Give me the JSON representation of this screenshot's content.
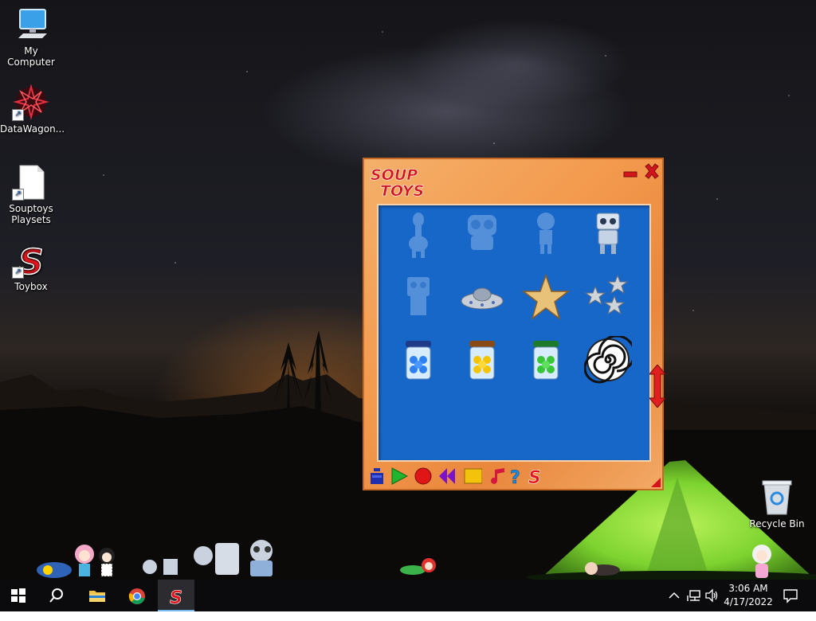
{
  "desktop": {
    "icons": [
      {
        "label": "My Computer",
        "icon": "computer-icon"
      },
      {
        "label": "DataWagon...",
        "icon": "datawagon-icon"
      },
      {
        "label": "Souptoys Playsets",
        "icon": "document-icon"
      },
      {
        "label": "Toybox",
        "icon": "souptoys-s-icon"
      },
      {
        "label": "Recycle Bin",
        "icon": "recycle-bin-icon"
      }
    ]
  },
  "app": {
    "logo_line1": "SOUP",
    "logo_line2": "TOYS",
    "toys": [
      {
        "name": "alien-toy",
        "faded": true
      },
      {
        "name": "owl-robot-toy",
        "faded": true
      },
      {
        "name": "girl-doll-toy",
        "faded": true
      },
      {
        "name": "robot-toy",
        "faded": false
      },
      {
        "name": "square-robot-toy",
        "faded": true
      },
      {
        "name": "flying-saucer-toy",
        "faded": false
      },
      {
        "name": "gold-star-toy",
        "faded": false
      },
      {
        "name": "silver-stars-toy",
        "faded": false
      },
      {
        "name": "blue-gumball-jar-toy",
        "faded": false
      },
      {
        "name": "yellow-gumball-jar-toy",
        "faded": false
      },
      {
        "name": "green-gumball-jar-toy",
        "faded": false
      },
      {
        "name": "spiral-toy",
        "faded": false
      }
    ],
    "toolbar": [
      {
        "name": "stopwatch-icon"
      },
      {
        "name": "play-icon"
      },
      {
        "name": "record-icon"
      },
      {
        "name": "rewind-icon"
      },
      {
        "name": "stop-icon"
      },
      {
        "name": "music-note-icon"
      },
      {
        "name": "help-icon"
      },
      {
        "name": "souptoys-s-icon"
      }
    ],
    "colors": {
      "frame": "#f39a4e",
      "grid": "#1767c9",
      "accent": "#e02020"
    }
  },
  "taskbar": {
    "items": [
      {
        "name": "start-button",
        "icon": "windows-logo-icon"
      },
      {
        "name": "search-button",
        "icon": "search-icon"
      },
      {
        "name": "file-explorer-button",
        "icon": "folder-icon"
      },
      {
        "name": "chrome-button",
        "icon": "chrome-icon"
      },
      {
        "name": "souptoys-button",
        "icon": "souptoys-s-icon",
        "active": true
      }
    ],
    "clock": {
      "time": "3:06 AM",
      "date": "4/17/2022"
    }
  }
}
